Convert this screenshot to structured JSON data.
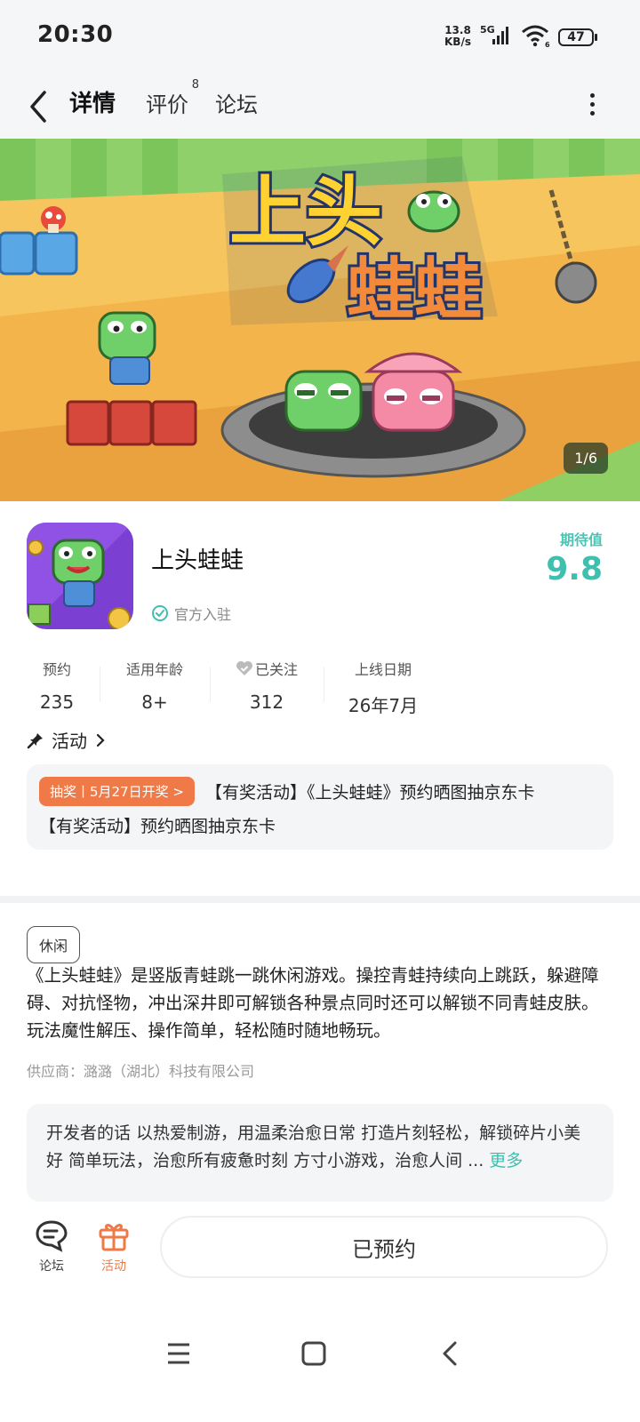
{
  "status_bar": {
    "time": "20:30",
    "net_speed_value": "13.8",
    "net_speed_unit": "KB/s",
    "network": "5G",
    "wifi_sub": "6",
    "battery": "47"
  },
  "nav": {
    "tabs": [
      {
        "label": "详情",
        "active": true
      },
      {
        "label": "评价",
        "badge": "8"
      },
      {
        "label": "论坛"
      }
    ]
  },
  "banner": {
    "logo_line1": "上头",
    "logo_line2": "蛙蛙",
    "counter": "1/6"
  },
  "app": {
    "name": "上头蛙蛙",
    "official": "官方入驻",
    "expect_label": "期待值",
    "expect_value": "9.8"
  },
  "stats": [
    {
      "label": "预约",
      "value": "235"
    },
    {
      "label": "适用年龄",
      "value": "8+"
    },
    {
      "label": "已关注",
      "value": "312"
    },
    {
      "label": "上线日期",
      "value": "26年7月"
    }
  ],
  "activity": {
    "heading": "活动",
    "pill": "抽奖丨5月27日开奖 >",
    "title": "【有奖活动】《上头蛙蛙》预约晒图抽京东卡",
    "subtitle": "【有奖活动】预约晒图抽京东卡"
  },
  "description": {
    "tag": "休闲",
    "intro": "《上头蛙蛙》是竖版青蛙跳一跳休闲游戏。操控青蛙持续向上跳跃，躲避障碍、对抗怪物，冲出深井即可解锁各种景点同时还可以解锁不同青蛙皮肤。玩法魔性解压、操作简单，轻松随时随地畅玩。",
    "supplier": "供应商：潞潞（湖北）科技有限公司",
    "dev_words": "开发者的话  以热爱制游，用温柔治愈日常 打造片刻轻松，解锁碎片小美好 简单玩法，治愈所有疲惫时刻 方寸小游戏，治愈人间 ...",
    "more": "更多"
  },
  "action_bar": {
    "forum_label": "论坛",
    "activity_label": "活动",
    "reserve_label": "已预约"
  },
  "colors": {
    "accent": "#3fbfae",
    "orange": "#f07a47"
  }
}
